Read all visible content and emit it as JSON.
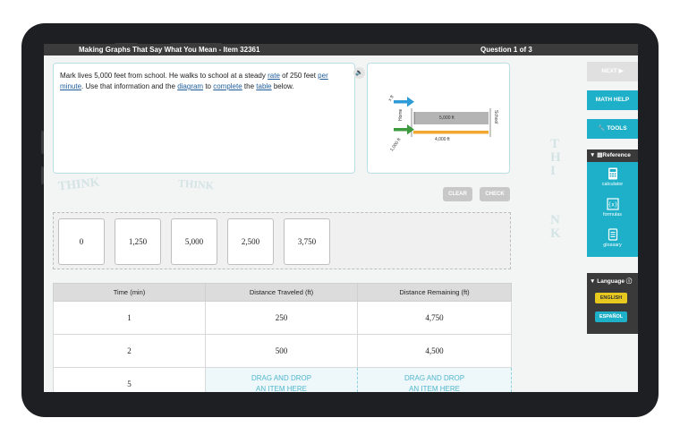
{
  "header": {
    "title": "Making Graphs That Say What You Mean - Item 32361",
    "question_counter": "Question 1 of 3"
  },
  "question": {
    "text_1": "Mark lives 5,000 feet from school. He walks to school at a steady ",
    "link_rate": "rate",
    "text_2": " of 250 feet ",
    "link_per": "per",
    "text_3": " ",
    "link_minute": "minute",
    "text_4": ". Use that information and the ",
    "link_diagram": "diagram",
    "text_5": " to ",
    "link_complete": "complete",
    "text_6": " the ",
    "link_table": "table",
    "text_7": " below."
  },
  "diagram": {
    "home_label": "Home",
    "school_label": "School",
    "blue_arrow_label": "x ft",
    "green_arrow_label": "1,000 ft",
    "gray_bar_label": "5,000 ft",
    "orange_bar_label": "4,000 ft",
    "colors": {
      "blue": "#2f9bd6",
      "green": "#3d9a3f",
      "gray": "#b4b4b4",
      "orange": "#f0a830"
    }
  },
  "actions": {
    "clear": "CLEAR",
    "check": "CHECK"
  },
  "tiles": [
    "0",
    "1,250",
    "5,000",
    "2,500",
    "3,750"
  ],
  "table": {
    "headers": [
      "Time (min)",
      "Distance Traveled (ft)",
      "Distance Remaining (ft)"
    ],
    "rows": [
      [
        "1",
        "250",
        "4,750"
      ],
      [
        "2",
        "500",
        "4,500"
      ],
      [
        "5",
        "",
        ""
      ]
    ],
    "drop_line_1": "DRAG AND DROP",
    "drop_line_2": "AN ITEM HERE"
  },
  "sidebar": {
    "next": "NEXT ▶",
    "math_help": "MATH HELP",
    "tools": "TOOLS",
    "reference_title": "Reference",
    "reference_items": [
      "calculator",
      "formulas",
      "glossary"
    ],
    "language_title": "Language",
    "languages": [
      "ENGLISH",
      "ESPAÑOL"
    ]
  },
  "watermark_words": [
    "THINK",
    "THINK",
    "THINK",
    "THINK",
    "THI",
    "NK"
  ],
  "colors": {
    "accent": "#1db0c8",
    "english": "#e6c81f",
    "espanol": "#1db0c8"
  }
}
